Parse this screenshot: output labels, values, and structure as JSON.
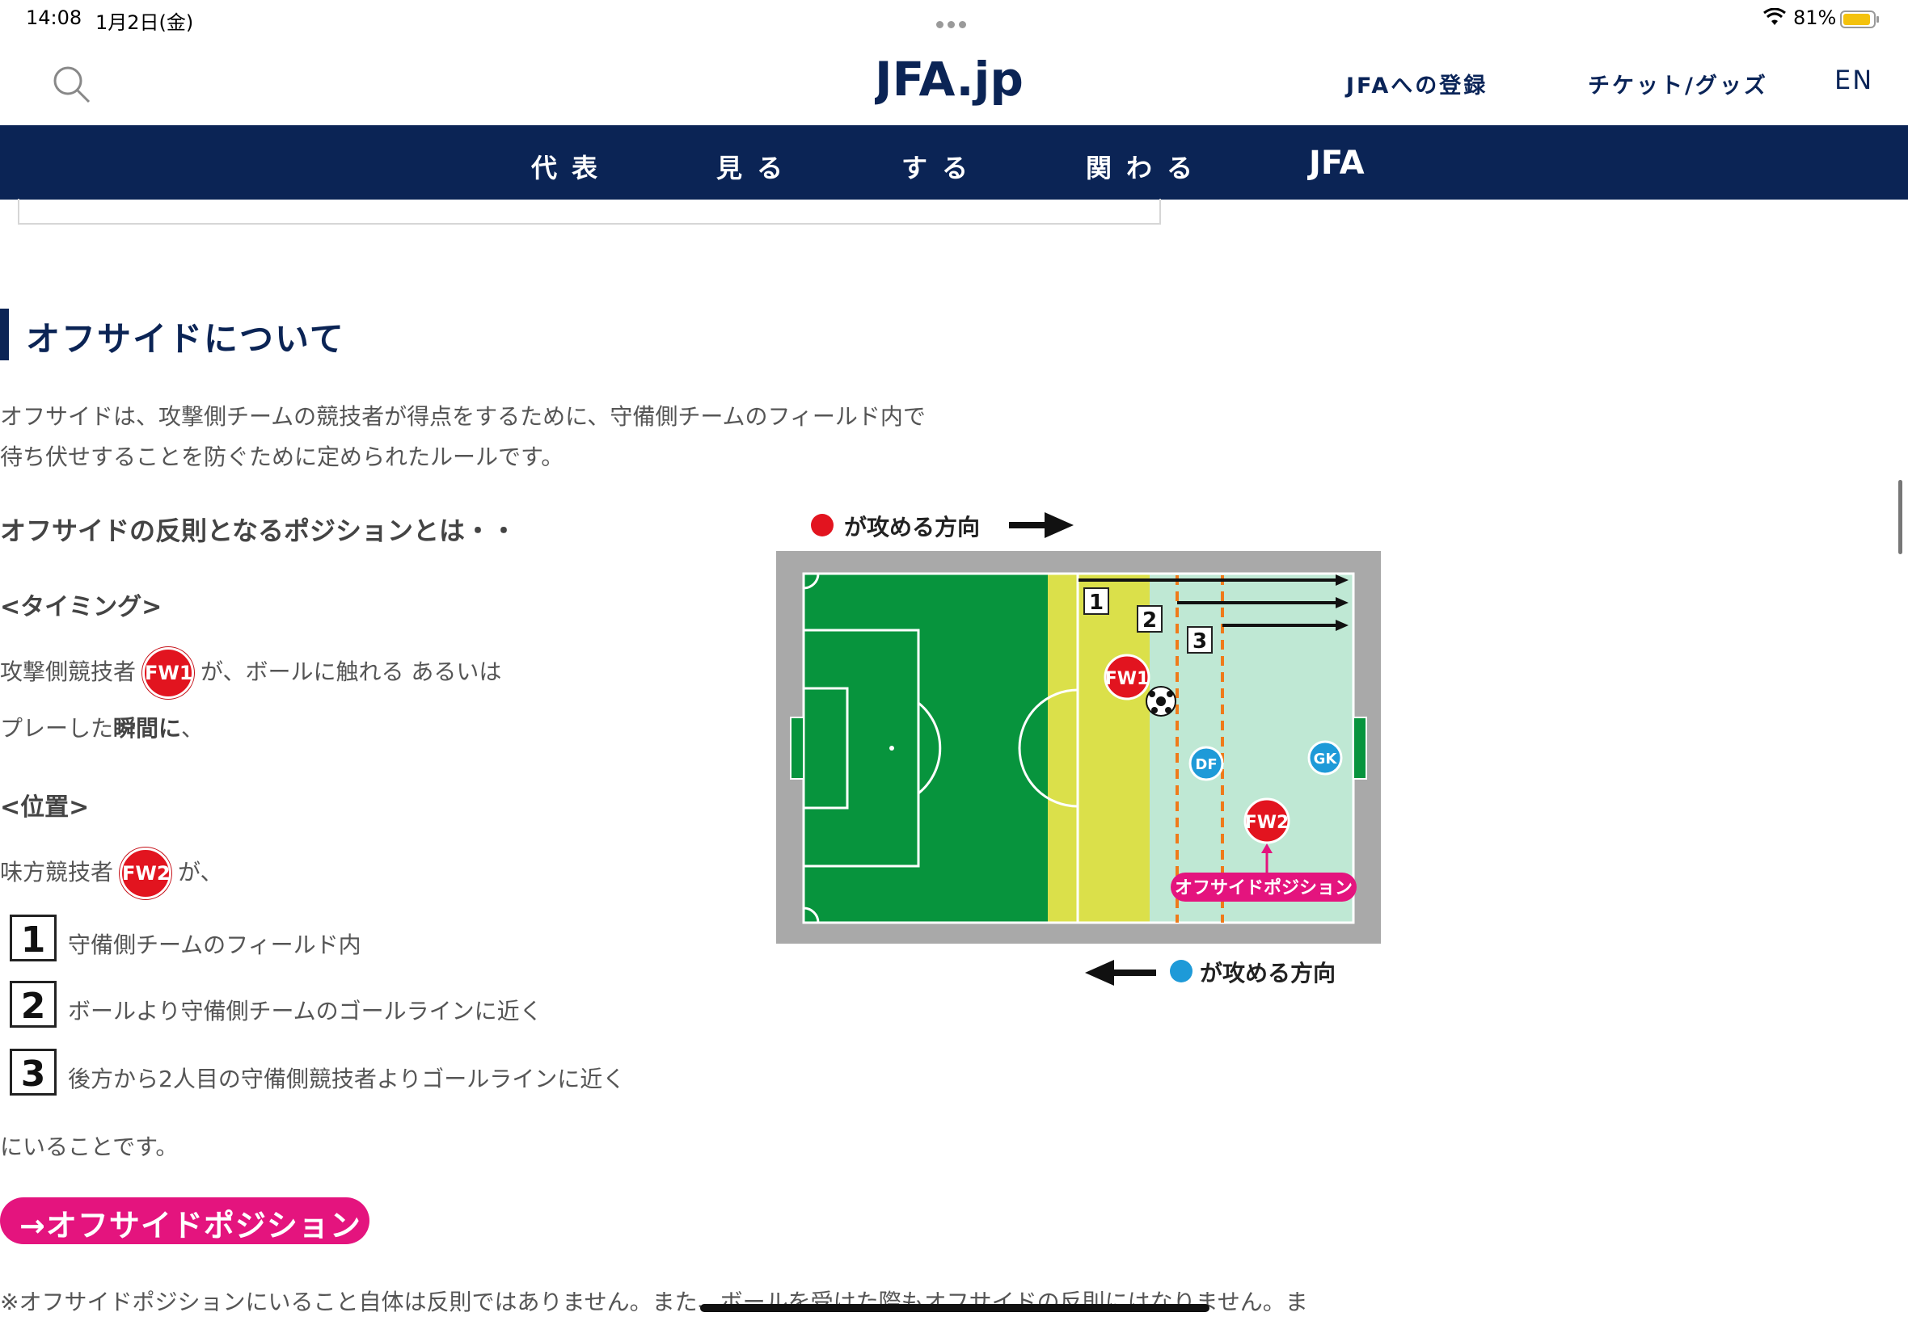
{
  "status_bar": {
    "time": "14:08",
    "date": "1月2日(金)",
    "battery_pct": "81%"
  },
  "header": {
    "logo_text": "JFA.jp",
    "nav_register": "JFAへの登録",
    "nav_ticket": "チケット/グッズ",
    "nav_language": "EN"
  },
  "main_nav": {
    "items": [
      "代表",
      "見る",
      "する",
      "関わる"
    ],
    "jfa_logo_text": "JFA"
  },
  "section": {
    "title": "オフサイドについて",
    "intro_line1": "オフサイドは、攻撃側チームの競技者が得点をするために、守備側チームのフィールド内で",
    "intro_line2": "待ち伏せすることを防ぐために定められたルールです。",
    "subheading": "オフサイドの反則となるポジションとは・・",
    "timing_heading": "<タイミング>",
    "timing_prefix": "攻撃側競技者",
    "fw1_label": "FW1",
    "timing_suffix": "が、ボールに触れる あるいは",
    "timing_line2_a": "プレーした",
    "timing_line2_b": "瞬間に",
    "timing_line2_c": "、",
    "position_heading": "<位置>",
    "position_prefix": "味方競技者",
    "fw2_label": "FW2",
    "position_suffix": "が、",
    "conditions": [
      {
        "num": "1",
        "text": "守備側チームのフィールド内"
      },
      {
        "num": "2",
        "text": "ボールより守備側チームのゴールラインに近く"
      },
      {
        "num": "3",
        "text": "後方から2人目の守備側競技者よりゴールラインに近く"
      }
    ],
    "conclusion": "にいることです。",
    "offside_pill": "→オフサイドポジション",
    "note": "※オフサイドポジションにいること自体は反則ではありません。また、ボールを受けた際もオフサイドの反則にはなりません。ま"
  },
  "diagram": {
    "red_direction_label": "が攻める方向",
    "blue_direction_label": "が攻める方向",
    "markers": [
      "1",
      "2",
      "3"
    ],
    "players": {
      "fw1": "FW1",
      "fw2": "FW2",
      "df": "DF",
      "gk": "GK"
    },
    "offside_tag": "オフサイドポジション",
    "colors": {
      "pitch": "#07943d",
      "defending_zone": "#dbe04a",
      "offside_zone": "#bfe8d4",
      "border": "#a9a9a9",
      "red": "#e2141f",
      "blue": "#1e9ad8",
      "pink": "#e4147e",
      "orange_line": "#ef7a1a"
    }
  }
}
